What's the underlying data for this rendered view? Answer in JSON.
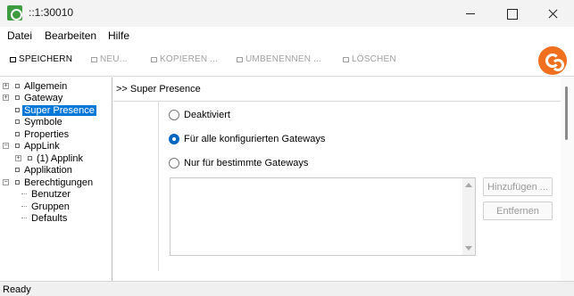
{
  "window": {
    "title": "::1:30010"
  },
  "menu": [
    "Datei",
    "Bearbeiten",
    "Hilfe"
  ],
  "toolbar": {
    "save": "SPEICHERN",
    "new": "NEU...",
    "copy": "KOPIEREN ...",
    "rename": "UMBENENNEN ...",
    "delete": "LÖSCHEN"
  },
  "tree": [
    {
      "label": "Allgemein"
    },
    {
      "label": "Gateway"
    },
    {
      "label": "Super Presence",
      "selected": true
    },
    {
      "label": "Symbole"
    },
    {
      "label": "Properties"
    },
    {
      "label": "AppLink"
    },
    {
      "label": "(1) Applink"
    },
    {
      "label": "Applikation"
    },
    {
      "label": "Berechtigungen"
    },
    {
      "label": "Benutzer"
    },
    {
      "label": "Gruppen"
    },
    {
      "label": "Defaults"
    }
  ],
  "content": {
    "header": ">> Super Presence",
    "options": [
      {
        "label": "Deaktiviert",
        "checked": false
      },
      {
        "label": "Für alle konfigurierten Gateways",
        "checked": true
      },
      {
        "label": "Nur für bestimmte Gateways",
        "checked": false
      }
    ],
    "add_button": "Hinzufügen ...",
    "remove_button": "Entfernen"
  },
  "status": "Ready",
  "colors": {
    "selection": "#0078d7",
    "brand": "#f07020",
    "radio_checked": "#0067c0"
  }
}
